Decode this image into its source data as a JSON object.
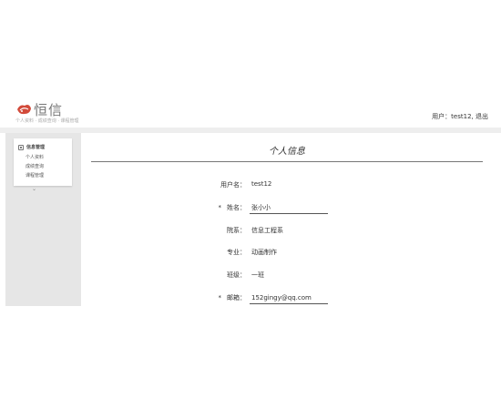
{
  "brand": {
    "name": "恒信",
    "slogan": "个人资料 · 成绩查询 · 课程管理",
    "logo_color": "#d24a3a"
  },
  "header": {
    "user_label": "用户：",
    "username": "test12",
    "separator": ",",
    "logout": "退出"
  },
  "sidebar": {
    "group_title": "信息管理",
    "items": [
      {
        "label": "个人资料"
      },
      {
        "label": "成绩查询"
      },
      {
        "label": "课程管理"
      }
    ],
    "toggle": "⌄"
  },
  "main": {
    "title": "个人信息",
    "fields": [
      {
        "label": "用户名：",
        "value": "test12",
        "required": false,
        "editable": false
      },
      {
        "label": "姓名：",
        "value": "张小小",
        "required": true,
        "editable": true
      },
      {
        "label": "院系：",
        "value": "信息工程系",
        "required": false,
        "editable": false
      },
      {
        "label": "专业：",
        "value": "动画制作",
        "required": false,
        "editable": false
      },
      {
        "label": "班级：",
        "value": "一班",
        "required": false,
        "editable": false
      },
      {
        "label": "邮箱：",
        "value": "152gingy@qq.com",
        "required": true,
        "editable": true
      }
    ],
    "required_mark": "*"
  }
}
